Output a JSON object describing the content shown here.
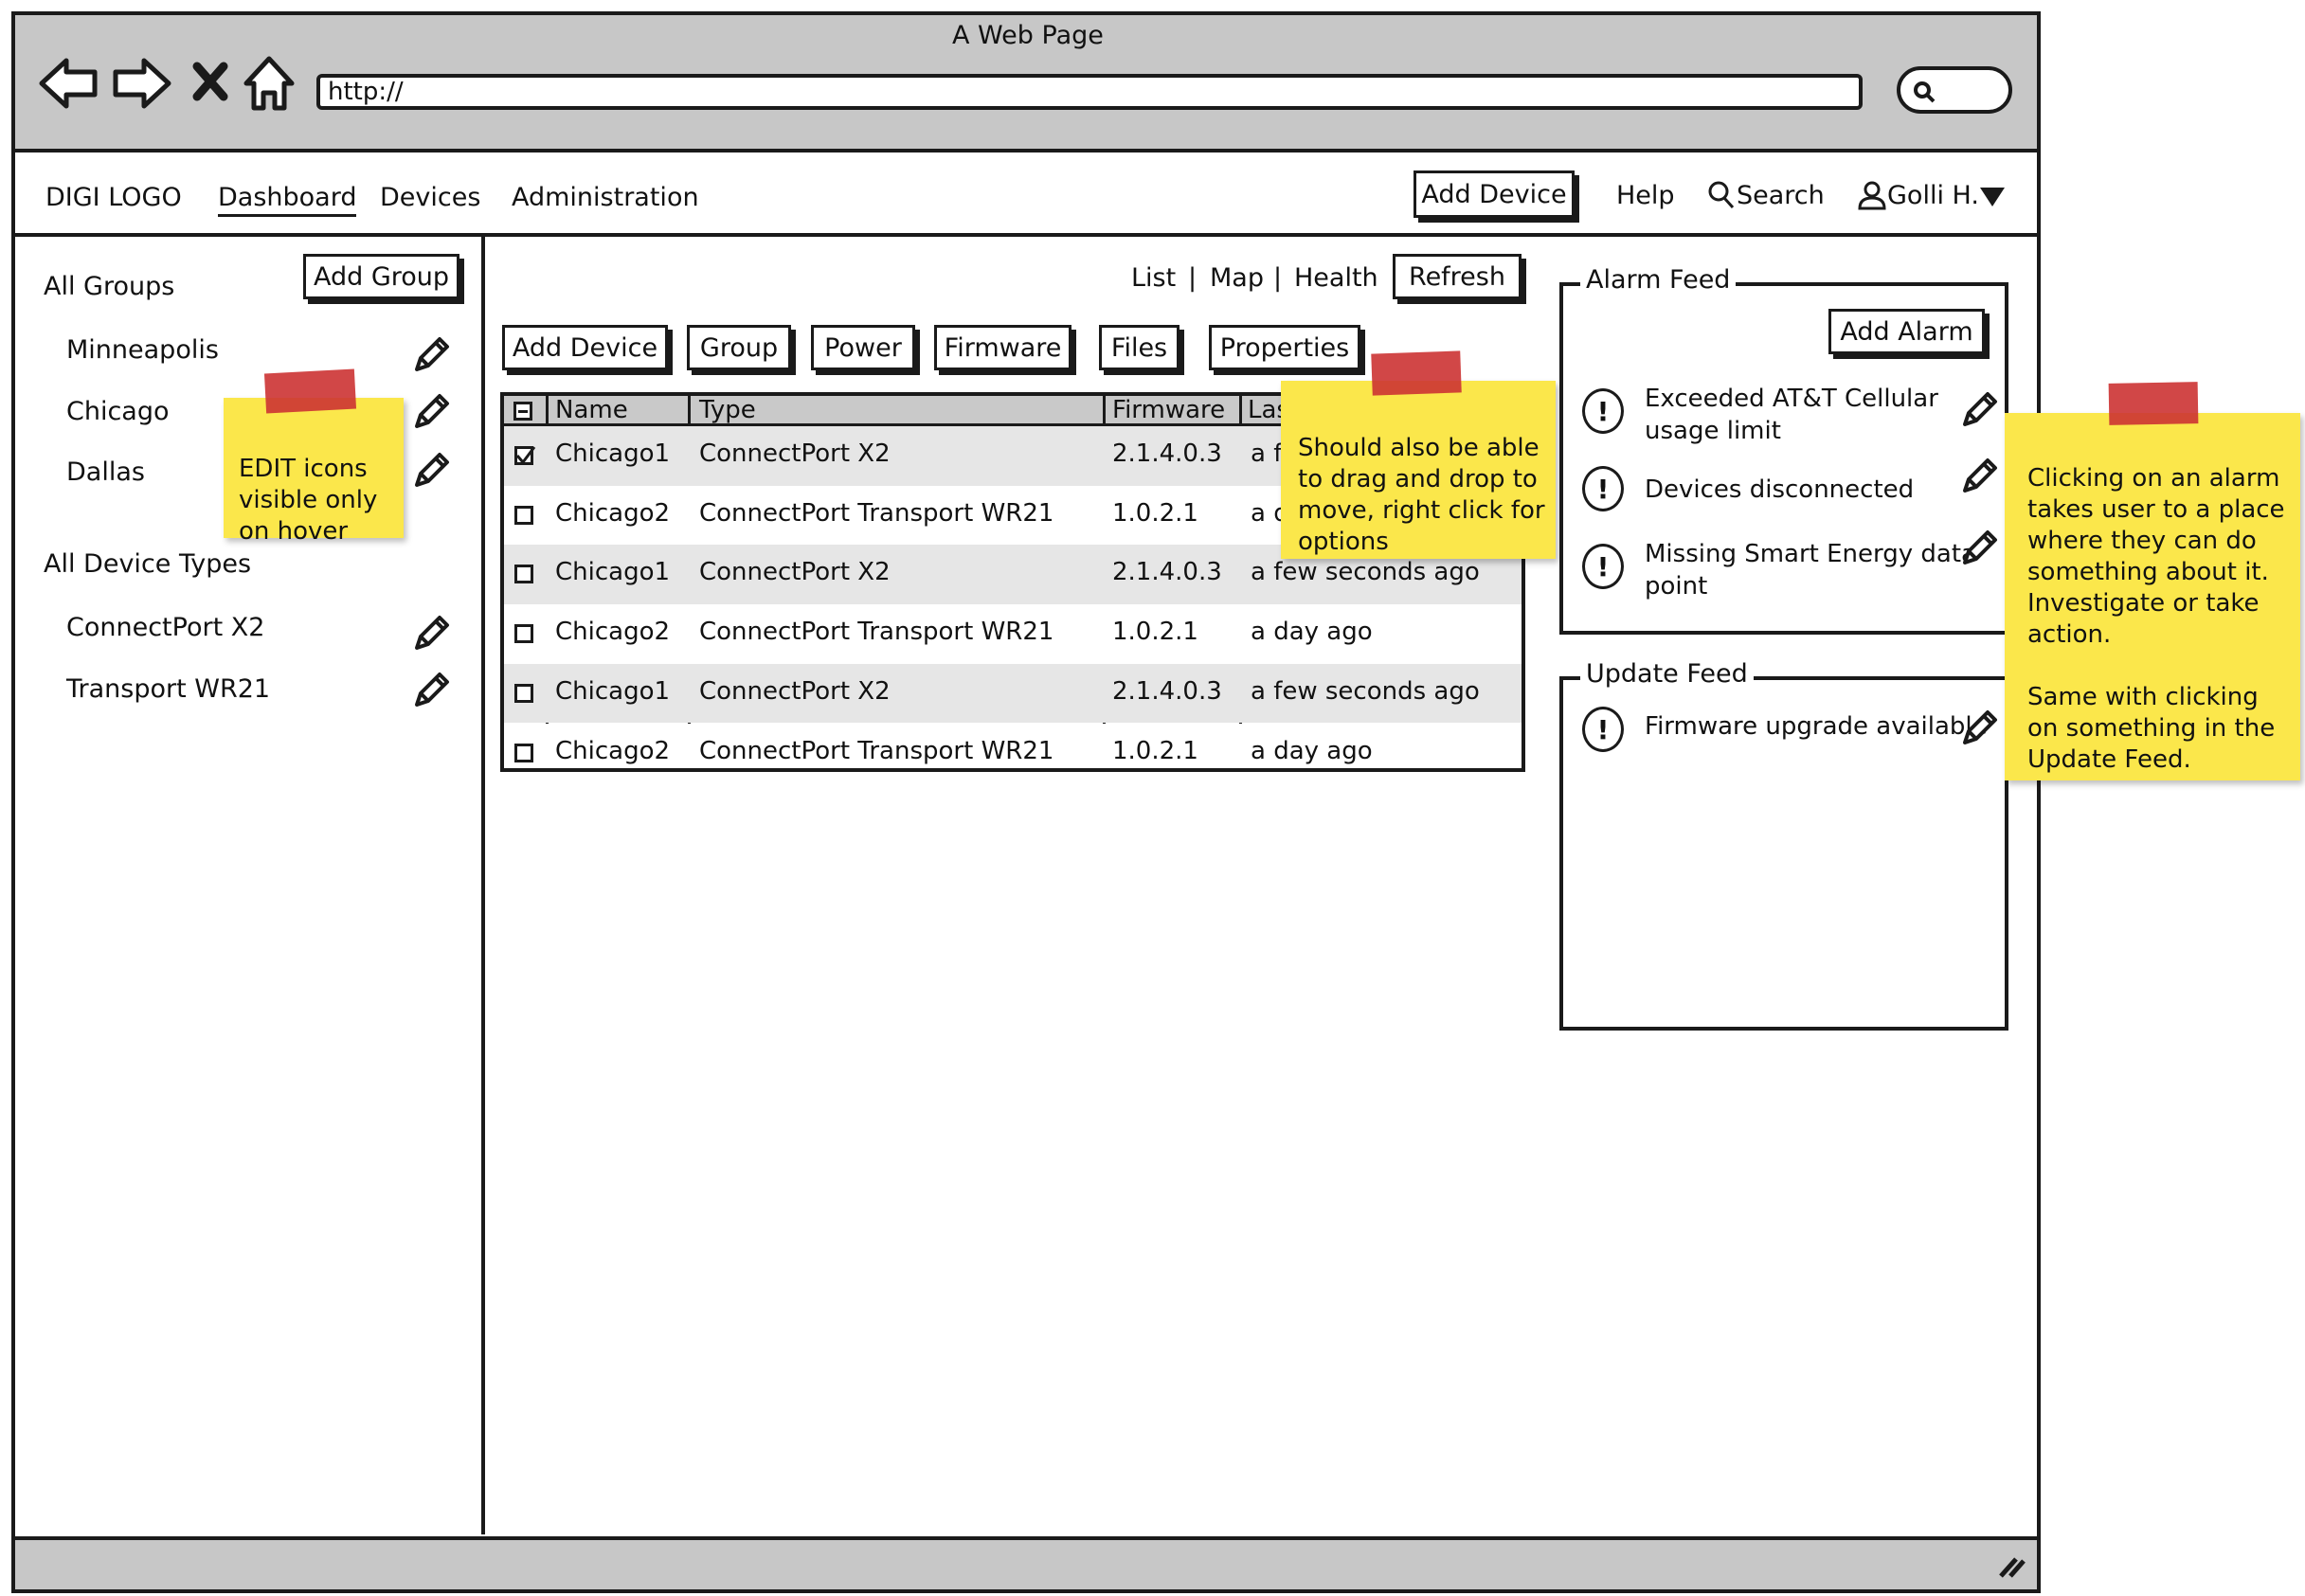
{
  "window": {
    "title": "A Web Page",
    "url": "http://"
  },
  "nav": {
    "logo": "DIGI LOGO",
    "items": [
      "Dashboard",
      "Devices",
      "Administration"
    ],
    "add_device": "Add Device",
    "help": "Help",
    "search": "Search",
    "user": "Golli H."
  },
  "sidebar": {
    "groups_header": "All Groups",
    "add_group": "Add Group",
    "groups": [
      "Minneapolis",
      "Chicago",
      "Dallas"
    ],
    "types_header": "All Device Types",
    "types": [
      "ConnectPort X2",
      "Transport WR21"
    ]
  },
  "views": {
    "list": "List",
    "map": "Map",
    "health": "Health",
    "refresh": "Refresh"
  },
  "toolbar": {
    "add_device": "Add Device",
    "group": "Group",
    "power": "Power",
    "firmware": "Firmware",
    "files": "Files",
    "properties": "Properties"
  },
  "table": {
    "headers": [
      "Name",
      "Type",
      "Firmware",
      "Last"
    ],
    "rows": [
      {
        "checked": true,
        "name": "Chicago1",
        "type": "ConnectPort X2",
        "firmware": "2.1.4.0.3",
        "last": "a few seconds ago"
      },
      {
        "checked": false,
        "name": "Chicago2",
        "type": "ConnectPort Transport WR21",
        "firmware": "1.0.2.1",
        "last": "a day ago"
      },
      {
        "checked": false,
        "name": "Chicago1",
        "type": "ConnectPort X2",
        "firmware": "2.1.4.0.3",
        "last": "a few seconds ago"
      },
      {
        "checked": false,
        "name": "Chicago2",
        "type": "ConnectPort Transport WR21",
        "firmware": "1.0.2.1",
        "last": "a day ago"
      },
      {
        "checked": false,
        "name": "Chicago1",
        "type": "ConnectPort X2",
        "firmware": "2.1.4.0.3",
        "last": "a few seconds ago"
      },
      {
        "checked": false,
        "name": "Chicago2",
        "type": "ConnectPort Transport WR21",
        "firmware": "1.0.2.1",
        "last": "a day ago"
      }
    ]
  },
  "alarm_feed": {
    "title": "Alarm Feed",
    "add_alarm": "Add Alarm",
    "items": [
      "Exceeded AT&T Cellular\nusage limit",
      "Devices disconnected",
      "Missing Smart Energy data\npoint"
    ]
  },
  "update_feed": {
    "title": "Update Feed",
    "items": [
      "Firmware upgrade available"
    ]
  },
  "notes": {
    "edit_icons": "EDIT icons\nvisible only\non hover",
    "drag_drop": "Should also be able\nto drag and drop to\nmove, right click for\noptions",
    "alarm_click": "Clicking on an alarm\ntakes user to a place\nwhere they can do\nsomething about it.\nInvestigate or take\naction.\n\nSame with clicking\non something in the\nUpdate Feed."
  },
  "colors": {
    "chrome": "#c7c7c7",
    "sticky": "#fbe74b",
    "tape": "#cc3333",
    "row_alt": "#e6e6e6"
  }
}
